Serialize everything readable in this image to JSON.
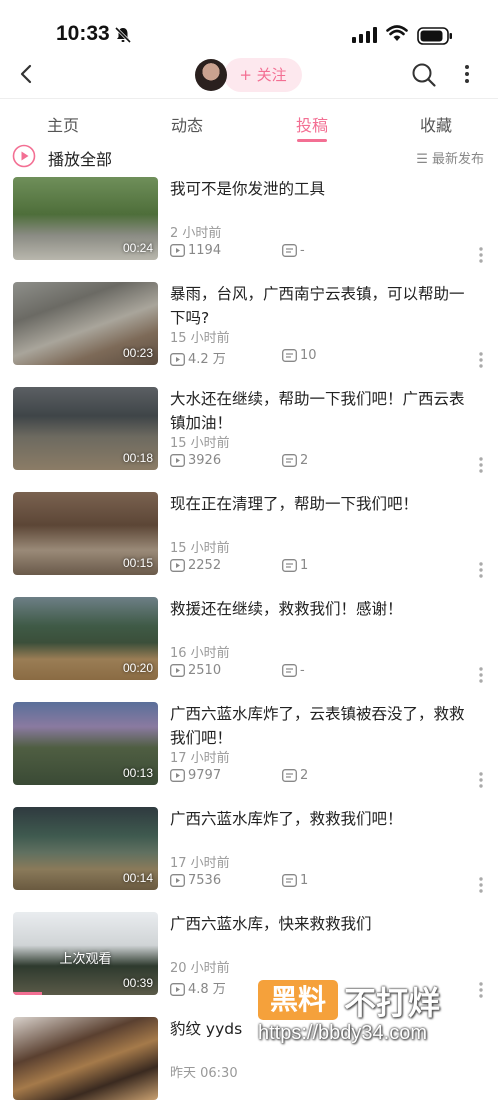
{
  "status_bar": {
    "time": "10:33"
  },
  "header": {
    "follow_label": "+ 关注"
  },
  "tabs": [
    {
      "label": "主页",
      "active": false
    },
    {
      "label": "动态",
      "active": false
    },
    {
      "label": "投稿",
      "active": true
    },
    {
      "label": "收藏",
      "active": false
    }
  ],
  "play_all": {
    "label": "播放全部",
    "sort_label": "☰ 最新发布"
  },
  "videos": [
    {
      "title": "我可不是你发泄的工具",
      "duration": "00:24",
      "time": "2 小时前",
      "views": "1194",
      "comments": "-",
      "overlay": "",
      "progress": 0
    },
    {
      "title": "暴雨，台风，广西南宁云表镇，可以帮助一下吗?",
      "duration": "00:23",
      "time": "15 小时前",
      "views": "4.2 万",
      "comments": "10",
      "overlay": "",
      "progress": 0
    },
    {
      "title": "大水还在继续，帮助一下我们吧！广西云表镇加油！",
      "duration": "00:18",
      "time": "15 小时前",
      "views": "3926",
      "comments": "2",
      "overlay": "",
      "progress": 0
    },
    {
      "title": "现在正在清理了，帮助一下我们吧！",
      "duration": "00:15",
      "time": "15 小时前",
      "views": "2252",
      "comments": "1",
      "overlay": "",
      "progress": 0
    },
    {
      "title": "救援还在继续，救救我们！感谢！",
      "duration": "00:20",
      "time": "16 小时前",
      "views": "2510",
      "comments": "-",
      "overlay": "",
      "progress": 0
    },
    {
      "title": "广西六蓝水库炸了，云表镇被吞没了，救救我们吧！",
      "duration": "00:13",
      "time": "17 小时前",
      "views": "9797",
      "comments": "2",
      "overlay": "",
      "progress": 0
    },
    {
      "title": "广西六蓝水库炸了，救救我们吧！",
      "duration": "00:14",
      "time": "17 小时前",
      "views": "7536",
      "comments": "1",
      "overlay": "",
      "progress": 0
    },
    {
      "title": "广西六蓝水库，快来救救我们",
      "duration": "00:39",
      "time": "20 小时前",
      "views": "4.8 万",
      "comments": "",
      "overlay": "上次观看",
      "progress": 0.2
    },
    {
      "title": "豹纹 yyds",
      "duration": "",
      "time": "昨天 06:30",
      "views": "",
      "comments": "",
      "overlay": "",
      "progress": 0
    }
  ],
  "watermark": {
    "logo": "黑料",
    "slogan": "不打烊",
    "url": "https://bbdy34.com"
  },
  "colors": {
    "accent": "#f36f93",
    "follow_bg": "#fde8ee"
  }
}
